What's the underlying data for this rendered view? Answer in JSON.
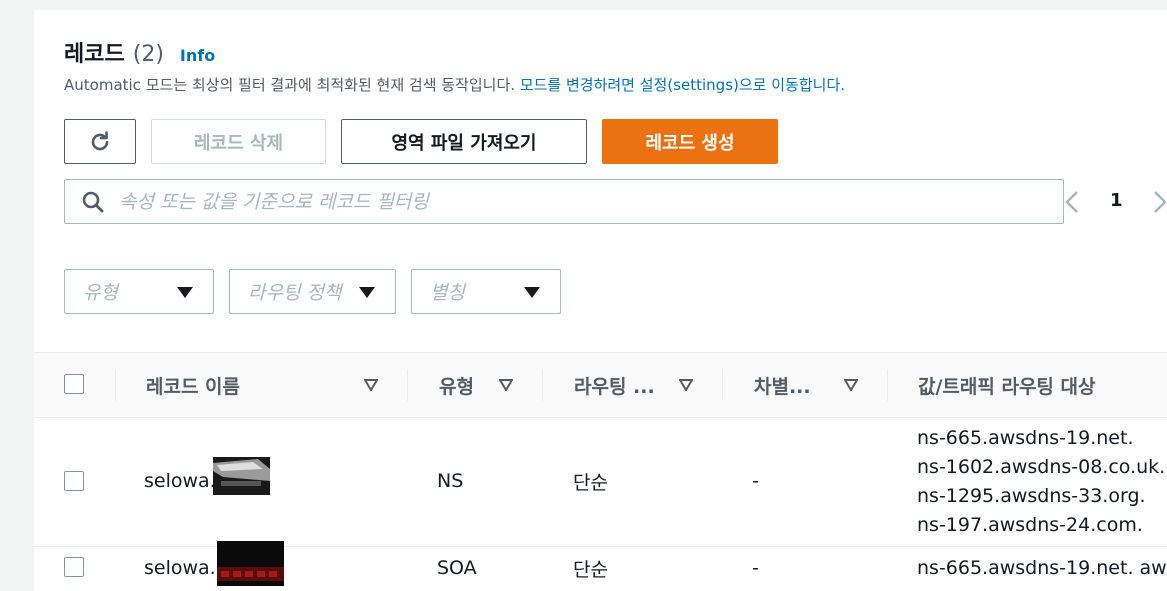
{
  "header": {
    "title": "레코드",
    "count": "(2)",
    "info": "Info",
    "description": "Automatic 모드는 최상의 필터 결과에 최적화된 현재 검색 동작입니다. ",
    "description_link": "모드를 변경하려면 설정(settings)으로 이동합니다."
  },
  "toolbar": {
    "delete_label": "레코드 삭제",
    "import_label": "영역 파일 가져오기",
    "create_label": "레코드 생성",
    "refresh_icon": "refresh-icon"
  },
  "search": {
    "placeholder": "속성 또는 값을 기준으로 레코드 필터링",
    "icon": "search-icon"
  },
  "pagination": {
    "current_page": "1"
  },
  "filters": {
    "type_placeholder": "유형",
    "routing_placeholder": "라우팅 정책",
    "alias_placeholder": "별칭"
  },
  "table": {
    "columns": [
      "레코드 이름",
      "유형",
      "라우팅 ...",
      "차별...",
      "값/트래픽 라우팅 대상"
    ],
    "rows": [
      {
        "name": "selowa.",
        "type": "NS",
        "routing": "단순",
        "diff": "-",
        "values": [
          "ns-665.awsdns-19.net.",
          "ns-1602.awsdns-08.co.uk.",
          "ns-1295.awsdns-33.org.",
          "ns-197.awsdns-24.com."
        ]
      },
      {
        "name": "selowa.",
        "type": "SOA",
        "routing": "단순",
        "diff": "-",
        "values": [
          "ns-665.awsdns-19.net. aw"
        ]
      }
    ]
  },
  "colors": {
    "primary": "#ec7211",
    "link": "#0073bb",
    "text": "#16191f",
    "muted": "#545b64"
  }
}
